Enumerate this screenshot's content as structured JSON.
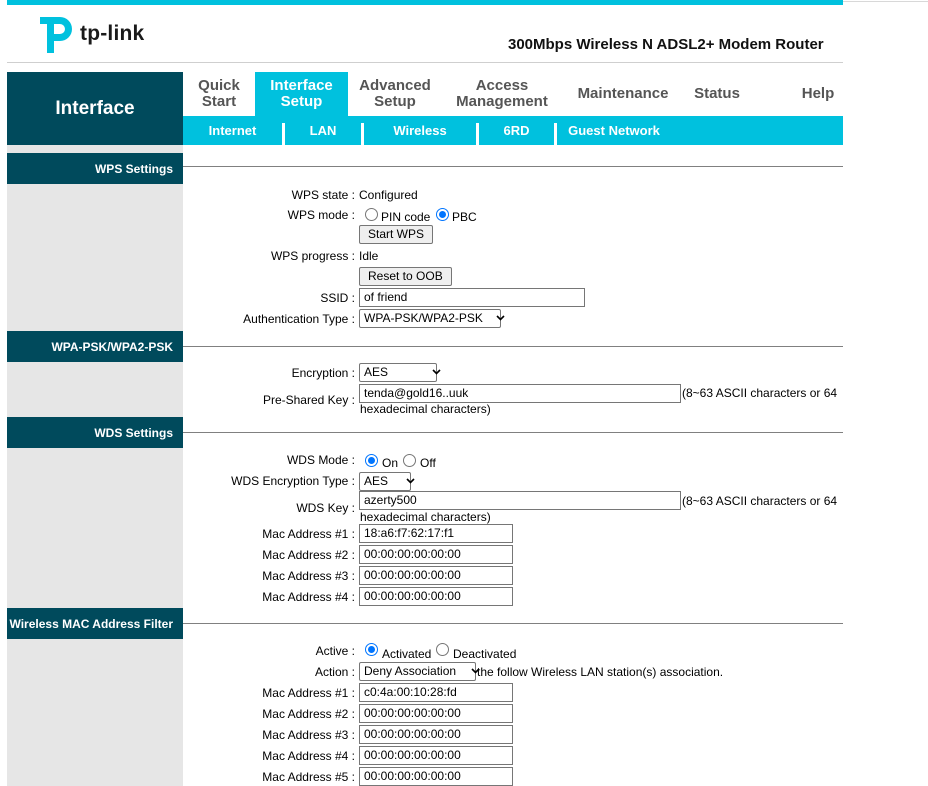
{
  "header": {
    "logo_text": "tp-link",
    "model": "300Mbps Wireless N ADSL2+ Modem Router"
  },
  "sidebar_title": "Interface",
  "menu": [
    {
      "label": "Quick Start"
    },
    {
      "label": "Interface Setup"
    },
    {
      "label": "Advanced Setup"
    },
    {
      "label": "Access Management"
    },
    {
      "label": "Maintenance"
    },
    {
      "label": "Status"
    },
    {
      "label": "Help"
    }
  ],
  "submenu": [
    "Internet",
    "LAN",
    "Wireless",
    "6RD",
    "Guest Network"
  ],
  "wps": {
    "title": "WPS Settings",
    "state_label": "WPS state :",
    "state_value": "Configured",
    "mode_label": "WPS mode :",
    "mode_pin": "PIN code",
    "mode_pbc": "PBC",
    "start_button": "Start WPS",
    "progress_label": "WPS progress :",
    "progress_value": "Idle",
    "reset_button": "Reset to OOB",
    "ssid_label": "SSID :",
    "ssid_value": "of friend",
    "auth_label": "Authentication Type :",
    "auth_value": "WPA-PSK/WPA2-PSK"
  },
  "wpa": {
    "title": "WPA-PSK/WPA2-PSK",
    "encryption_label": "Encryption :",
    "encryption_value": "AES",
    "psk_label": "Pre-Shared Key :",
    "psk_value": "tenda@gold16..uuk",
    "psk_note_1": "(8~63 ASCII characters or 64",
    "psk_note_2": "hexadecimal characters)"
  },
  "wds": {
    "title": "WDS Settings",
    "mode_label": "WDS Mode :",
    "mode_on": "On",
    "mode_off": "Off",
    "enc_label": "WDS Encryption Type :",
    "enc_value": "AES",
    "key_label": "WDS Key :",
    "key_value": "azerty500",
    "key_note_1": "(8~63 ASCII characters or 64",
    "key_note_2": "hexadecimal characters)",
    "macs": [
      {
        "label": "Mac Address #1 :",
        "value": "18:a6:f7:62:17:f1"
      },
      {
        "label": "Mac Address #2 :",
        "value": "00:00:00:00:00:00"
      },
      {
        "label": "Mac Address #3 :",
        "value": "00:00:00:00:00:00"
      },
      {
        "label": "Mac Address #4 :",
        "value": "00:00:00:00:00:00"
      }
    ]
  },
  "macfilter": {
    "title": "Wireless MAC Address Filter",
    "active_label": "Active :",
    "activated": "Activated",
    "deactivated": "Deactivated",
    "action_label": "Action :",
    "action_value": "Deny Association",
    "action_note": "the follow Wireless LAN station(s) association.",
    "macs": [
      {
        "label": "Mac Address #1 :",
        "value": "c0:4a:00:10:28:fd"
      },
      {
        "label": "Mac Address #2 :",
        "value": "00:00:00:00:00:00"
      },
      {
        "label": "Mac Address #3 :",
        "value": "00:00:00:00:00:00"
      },
      {
        "label": "Mac Address #4 :",
        "value": "00:00:00:00:00:00"
      },
      {
        "label": "Mac Address #5 :",
        "value": "00:00:00:00:00:00"
      }
    ]
  },
  "colors": {
    "accent": "#00c1de",
    "dark": "#004a5c",
    "sidebar_bg": "#e6e6e6",
    "radio_selected": "#0075ff"
  }
}
